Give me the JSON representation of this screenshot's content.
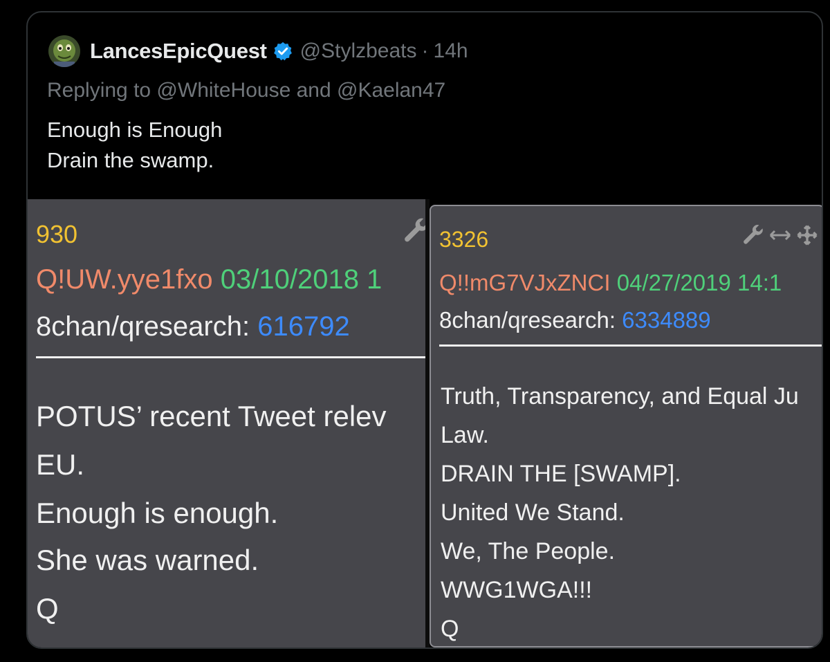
{
  "tweet": {
    "display_name": "LancesEpicQuest",
    "handle": "@Stylzbeats",
    "separator": "·",
    "time": "14h",
    "replying_to": "Replying to @WhiteHouse and @Kaelan47",
    "text_lines": [
      "Enough is Enough",
      "Drain the swamp."
    ],
    "verified_color": "#1d9bf0"
  },
  "media": {
    "left_post": {
      "number": "930",
      "tripcode": "Q!UW.yye1fxo",
      "date": "03/10/2018 1",
      "board": "8chan/qresearch:",
      "ref": "616792",
      "lines": [
        "POTUS’ recent Tweet relev",
        "EU.",
        "Enough is enough.",
        "She was warned.",
        "Q"
      ]
    },
    "right_post": {
      "number": "3326",
      "tripcode": "Q!!mG7VJxZNCI",
      "date": "04/27/2019 14:1",
      "board": "8chan/qresearch:",
      "ref": "6334889",
      "lines": [
        "Truth, Transparency, and Equal Ju",
        "Law.",
        "DRAIN THE [SWAMP].",
        "United We Stand.",
        "We, The People.",
        "WWG1WGA!!!",
        "Q"
      ]
    }
  }
}
